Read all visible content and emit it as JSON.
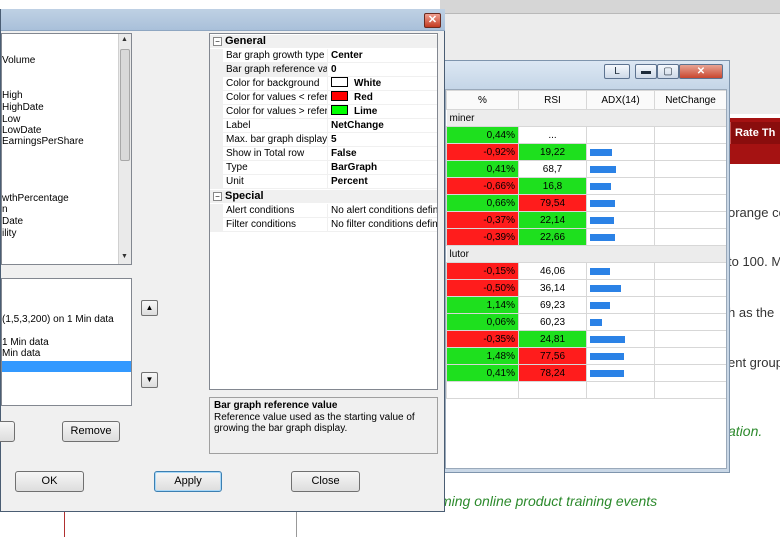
{
  "background_page": {
    "rate_button": "Rate Th",
    "text_lines": [
      "orange co",
      "to 100. M",
      "h as the",
      "ent group"
    ],
    "green_italic_1": "ation.",
    "green_italic_2": "ming online product training events"
  },
  "quote_window": {
    "buttons": {
      "l": "L",
      "minimize": "▬",
      "maximize": "▢",
      "close": "✕"
    },
    "columns": [
      "%",
      "RSI",
      "ADX(14)",
      "NetChange"
    ],
    "groups": [
      {
        "label": "miner",
        "rows": [
          {
            "pct": "0,44%",
            "rsi": "...",
            "pct_dir": "pos",
            "rsi_dir": "neu",
            "adx": 0
          },
          {
            "pct": "-0,92%",
            "rsi": "19,22",
            "pct_dir": "neg",
            "rsi_dir": "pos",
            "adx": 0.36
          },
          {
            "pct": "0,41%",
            "rsi": "68,7",
            "pct_dir": "pos",
            "rsi_dir": "neu",
            "adx": 0.42
          },
          {
            "pct": "-0,66%",
            "rsi": "16,8",
            "pct_dir": "neg",
            "rsi_dir": "pos",
            "adx": 0.34
          },
          {
            "pct": "0,66%",
            "rsi": "79,54",
            "pct_dir": "pos",
            "rsi_dir": "neg",
            "adx": 0.4
          },
          {
            "pct": "-0,37%",
            "rsi": "22,14",
            "pct_dir": "neg",
            "rsi_dir": "pos",
            "adx": 0.38
          },
          {
            "pct": "-0,39%",
            "rsi": "22,66",
            "pct_dir": "neg",
            "rsi_dir": "pos",
            "adx": 0.4
          }
        ]
      },
      {
        "label": "lutor",
        "rows": [
          {
            "pct": "-0,15%",
            "rsi": "46,06",
            "pct_dir": "neg",
            "rsi_dir": "neu",
            "adx": 0.32
          },
          {
            "pct": "-0,50%",
            "rsi": "36,14",
            "pct_dir": "neg",
            "rsi_dir": "neu",
            "adx": 0.5
          },
          {
            "pct": "1,14%",
            "rsi": "69,23",
            "pct_dir": "pos",
            "rsi_dir": "neu",
            "adx": 0.32
          },
          {
            "pct": "0,06%",
            "rsi": "60,23",
            "pct_dir": "pos",
            "rsi_dir": "neu",
            "adx": 0.2
          },
          {
            "pct": "-0,35%",
            "rsi": "24,81",
            "pct_dir": "neg",
            "rsi_dir": "pos",
            "adx": 0.56
          },
          {
            "pct": "1,48%",
            "rsi": "77,56",
            "pct_dir": "pos",
            "rsi_dir": "neg",
            "adx": 0.55
          },
          {
            "pct": "0,41%",
            "rsi": "78,24",
            "pct_dir": "pos",
            "rsi_dir": "neg",
            "adx": 0.55
          }
        ]
      }
    ]
  },
  "dialog": {
    "close": "✕",
    "field_list": [
      "Volume",
      "High",
      "HighDate",
      "Low",
      "LowDate",
      "EarningsPerShare",
      "wthPercentage",
      "n",
      "Date",
      "ility"
    ],
    "study_list": [
      "(1,5,3,200) on 1 Min data",
      "1 Min data",
      "Min data"
    ],
    "up_arrow": "▲",
    "down_arrow": "▼",
    "remove_button": "Remove",
    "ok_button": "OK",
    "apply_button": "Apply",
    "close_button": "Close",
    "property_grid": {
      "general_category": "General",
      "special_category": "Special",
      "expander": "−",
      "general": [
        {
          "name": "Bar graph growth type",
          "value": "Center"
        },
        {
          "name": "Bar graph reference val",
          "value": "0"
        },
        {
          "name": "Color for background",
          "value": "White",
          "swatch": "#ffffff"
        },
        {
          "name": "Color for values < refer",
          "value": "Red",
          "swatch": "#ff0000"
        },
        {
          "name": "Color for values > refer",
          "value": "Lime",
          "swatch": "#00ff00"
        },
        {
          "name": "Label",
          "value": "NetChange"
        },
        {
          "name": "Max. bar graph display",
          "value": "5"
        },
        {
          "name": "Show in Total row",
          "value": "False"
        },
        {
          "name": "Type",
          "value": "BarGraph"
        },
        {
          "name": "Unit",
          "value": "Percent"
        }
      ],
      "special": [
        {
          "name": "Alert conditions",
          "value": "No alert conditions define"
        },
        {
          "name": "Filter conditions",
          "value": "No filter conditions defined"
        }
      ]
    },
    "description": {
      "title": "Bar graph reference value",
      "text": "Reference value used as the starting value of growing the bar graph display."
    }
  },
  "colors": {
    "positive": "#1ee01e",
    "negative": "#ff1c1c",
    "bar": "#2b82e6",
    "selection": "#3399ff",
    "web_red": "#a51212"
  }
}
